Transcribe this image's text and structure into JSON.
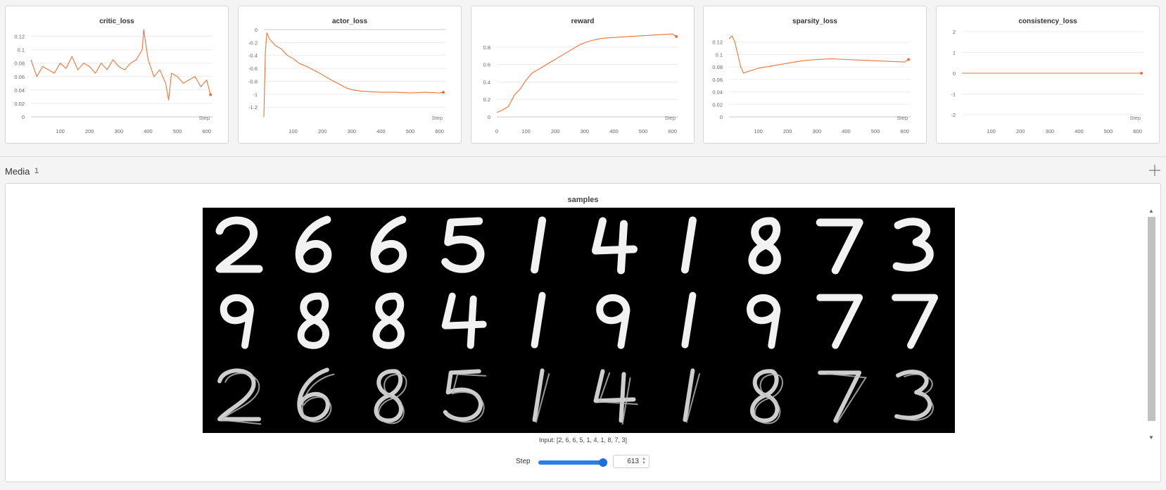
{
  "chart_data": [
    {
      "type": "line",
      "title": "critic_loss",
      "xlabel": "Step",
      "ylabel": "",
      "xlim": [
        0,
        620
      ],
      "ylim": [
        0,
        0.13
      ],
      "xticks": [
        100,
        200,
        300,
        400,
        500,
        600
      ],
      "yticks": [
        0,
        0.02,
        0.04,
        0.06,
        0.08,
        0.1,
        0.12
      ],
      "ytick_labels": [
        "0",
        "0.02",
        "0.04",
        "0.06",
        "0.08",
        "0.1",
        "0.12"
      ],
      "series": [
        {
          "color": "#e8743b",
          "x": [
            0,
            20,
            40,
            60,
            80,
            100,
            120,
            140,
            160,
            180,
            200,
            220,
            240,
            260,
            280,
            300,
            320,
            340,
            360,
            380,
            385,
            400,
            420,
            440,
            460,
            470,
            480,
            500,
            520,
            540,
            560,
            580,
            600,
            613
          ],
          "y": [
            0.085,
            0.06,
            0.075,
            0.07,
            0.065,
            0.08,
            0.072,
            0.09,
            0.07,
            0.08,
            0.075,
            0.065,
            0.08,
            0.07,
            0.085,
            0.075,
            0.07,
            0.08,
            0.085,
            0.1,
            0.13,
            0.085,
            0.06,
            0.07,
            0.05,
            0.025,
            0.065,
            0.06,
            0.05,
            0.055,
            0.06,
            0.045,
            0.055,
            0.033
          ]
        }
      ]
    },
    {
      "type": "line",
      "title": "actor_loss",
      "xlabel": "Step",
      "ylabel": "",
      "xlim": [
        0,
        620
      ],
      "ylim": [
        -1.35,
        0
      ],
      "xticks": [
        100,
        200,
        300,
        400,
        500,
        600
      ],
      "yticks": [
        0,
        -0.2,
        -0.4,
        -0.6,
        -0.8,
        -1,
        -1.2
      ],
      "ytick_labels": [
        "0",
        "-0.2",
        "-0.4",
        "-0.6",
        "-0.8",
        "-1",
        "-1.2"
      ],
      "series": [
        {
          "color": "#e8743b",
          "x": [
            0,
            5,
            10,
            20,
            40,
            60,
            80,
            100,
            120,
            150,
            180,
            200,
            230,
            260,
            280,
            300,
            330,
            360,
            400,
            450,
            500,
            550,
            600,
            613
          ],
          "y": [
            -1.35,
            -0.35,
            -0.05,
            -0.15,
            -0.25,
            -0.3,
            -0.4,
            -0.45,
            -0.52,
            -0.58,
            -0.65,
            -0.7,
            -0.78,
            -0.85,
            -0.9,
            -0.93,
            -0.95,
            -0.96,
            -0.97,
            -0.97,
            -0.98,
            -0.97,
            -0.98,
            -0.97
          ]
        }
      ]
    },
    {
      "type": "line",
      "title": "reward",
      "xlabel": "Step",
      "ylabel": "",
      "xlim": [
        0,
        620
      ],
      "ylim": [
        0,
        1.0
      ],
      "xticks": [
        0,
        100,
        200,
        300,
        400,
        500,
        600
      ],
      "yticks": [
        0,
        0.2,
        0.4,
        0.6,
        0.8
      ],
      "ytick_labels": [
        "0",
        "0.2",
        "0.4",
        "0.6",
        "0.8"
      ],
      "series": [
        {
          "color": "#e8743b",
          "x": [
            0,
            20,
            40,
            60,
            80,
            100,
            120,
            150,
            180,
            200,
            230,
            260,
            280,
            300,
            330,
            360,
            400,
            450,
            500,
            550,
            600,
            613
          ],
          "y": [
            0.05,
            0.08,
            0.12,
            0.25,
            0.32,
            0.42,
            0.5,
            0.56,
            0.62,
            0.66,
            0.72,
            0.78,
            0.82,
            0.85,
            0.88,
            0.9,
            0.91,
            0.92,
            0.93,
            0.94,
            0.95,
            0.92
          ]
        }
      ]
    },
    {
      "type": "line",
      "title": "sparsity_loss",
      "xlabel": "Step",
      "ylabel": "",
      "xlim": [
        0,
        620
      ],
      "ylim": [
        0,
        0.14
      ],
      "xticks": [
        100,
        200,
        300,
        400,
        500,
        600
      ],
      "yticks": [
        0,
        0.02,
        0.04,
        0.06,
        0.08,
        0.1,
        0.12
      ],
      "ytick_labels": [
        "0",
        "0.02",
        "0.04",
        "0.06",
        "0.08",
        "0.1",
        "0.12"
      ],
      "series": [
        {
          "color": "#e8743b",
          "x": [
            0,
            10,
            20,
            30,
            40,
            50,
            60,
            80,
            100,
            150,
            200,
            250,
            300,
            350,
            400,
            450,
            500,
            550,
            600,
            613
          ],
          "y": [
            0.125,
            0.13,
            0.12,
            0.1,
            0.08,
            0.07,
            0.072,
            0.075,
            0.078,
            0.082,
            0.086,
            0.09,
            0.092,
            0.093,
            0.092,
            0.091,
            0.09,
            0.089,
            0.088,
            0.092
          ]
        }
      ]
    },
    {
      "type": "line",
      "title": "consistency_loss",
      "xlabel": "Step",
      "ylabel": "",
      "xlim": [
        0,
        620
      ],
      "ylim": [
        -2.1,
        2.1
      ],
      "xticks": [
        100,
        200,
        300,
        400,
        500,
        600
      ],
      "yticks": [
        2,
        1,
        0,
        -1,
        -2
      ],
      "ytick_labels": [
        "2",
        "1",
        "0",
        "-1",
        "-2"
      ],
      "series": [
        {
          "color": "#e8743b",
          "x": [
            0,
            100,
            200,
            300,
            400,
            500,
            600,
            613
          ],
          "y": [
            0,
            0,
            0,
            0,
            0,
            0,
            0,
            0
          ]
        }
      ]
    }
  ],
  "media_section": {
    "title": "Media",
    "count": "1",
    "add_icon": "plus-icon"
  },
  "media_panel": {
    "title": "samples",
    "caption": "Input: [2, 6, 6, 5, 1, 4, 1, 8, 7, 3]",
    "digit_rows": [
      [
        2,
        6,
        6,
        5,
        1,
        4,
        1,
        8,
        7,
        3
      ],
      [
        9,
        8,
        8,
        4,
        1,
        9,
        1,
        9,
        7,
        7
      ],
      [
        2,
        6,
        8,
        5,
        1,
        4,
        1,
        8,
        7,
        3
      ]
    ],
    "step_label": "Step",
    "step_value": "613",
    "step_max": "613",
    "step_level": 1.0,
    "accent_color": "#1e6fd9"
  }
}
